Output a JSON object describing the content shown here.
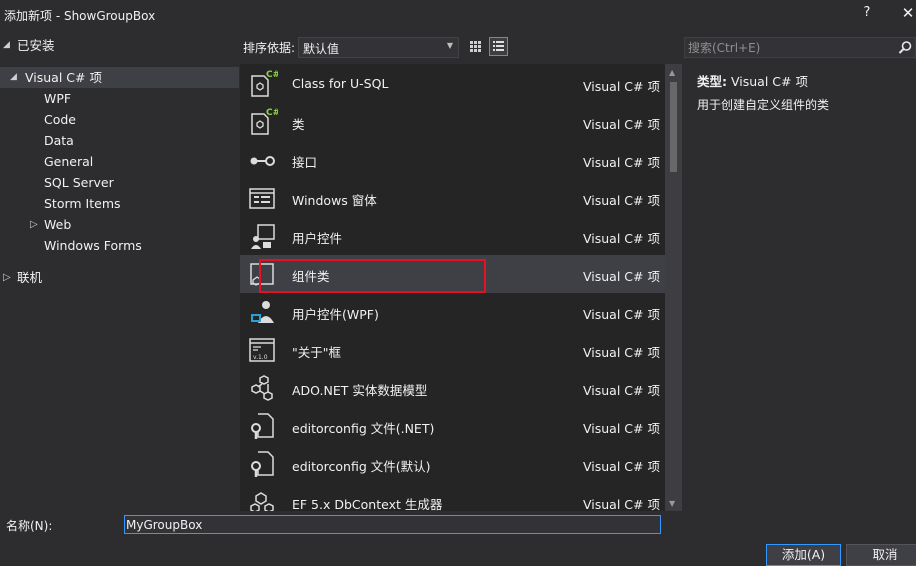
{
  "window": {
    "title": "添加新项 - ShowGroupBox",
    "help_label": "?",
    "close_label": "✕"
  },
  "tree": {
    "installed": "已安装",
    "online": "联机",
    "items": [
      {
        "label": "Visual C# 项",
        "expanded": true,
        "selected": true
      },
      {
        "label": "WPF"
      },
      {
        "label": "Code"
      },
      {
        "label": "Data"
      },
      {
        "label": "General"
      },
      {
        "label": "SQL Server"
      },
      {
        "label": "Storm Items"
      },
      {
        "label": "Web",
        "collapsed": true
      },
      {
        "label": "Windows Forms"
      }
    ]
  },
  "sort": {
    "label": "排序依据:",
    "value": "默认值"
  },
  "search": {
    "placeholder": "搜索(Ctrl+E)"
  },
  "templates": [
    {
      "name": "Class for U-SQL",
      "lang": "Visual C# 项",
      "icon": "csharp-class-icon"
    },
    {
      "name": "类",
      "lang": "Visual C# 项",
      "icon": "csharp-class-icon"
    },
    {
      "name": "接口",
      "lang": "Visual C# 项",
      "icon": "interface-icon"
    },
    {
      "name": "Windows 窗体",
      "lang": "Visual C# 项",
      "icon": "windows-form-icon"
    },
    {
      "name": "用户控件",
      "lang": "Visual C# 项",
      "icon": "user-control-icon"
    },
    {
      "name": "组件类",
      "lang": "Visual C# 项",
      "icon": "component-class-icon",
      "selected": true
    },
    {
      "name": "用户控件(WPF)",
      "lang": "Visual C# 项",
      "icon": "wpf-user-control-icon"
    },
    {
      "name": "\"关于\"框",
      "lang": "Visual C# 项",
      "icon": "about-box-icon"
    },
    {
      "name": "ADO.NET 实体数据模型",
      "lang": "Visual C# 项",
      "icon": "entity-model-icon"
    },
    {
      "name": "editorconfig 文件(.NET)",
      "lang": "Visual C# 项",
      "icon": "config-file-icon"
    },
    {
      "name": "editorconfig 文件(默认)",
      "lang": "Visual C# 项",
      "icon": "config-file-icon"
    },
    {
      "name": "EF 5.x DbContext 生成器",
      "lang": "Visual C# 项",
      "icon": "dbcontext-generator-icon"
    }
  ],
  "description": {
    "type_label": "类型:",
    "type_value": "Visual C# 项",
    "text": "用于创建自定义组件的类"
  },
  "footer": {
    "name_label": "名称(N):",
    "name_value": "MyGroupBox",
    "add_label": "添加(A)",
    "cancel_label": "取消"
  },
  "colors": {
    "background": "#2d2d30",
    "list_background": "#252526",
    "selection": "#3f3f46",
    "accent": "#3399ff",
    "highlight_box": "#e81123",
    "csharp_green": "#8ed34a"
  }
}
